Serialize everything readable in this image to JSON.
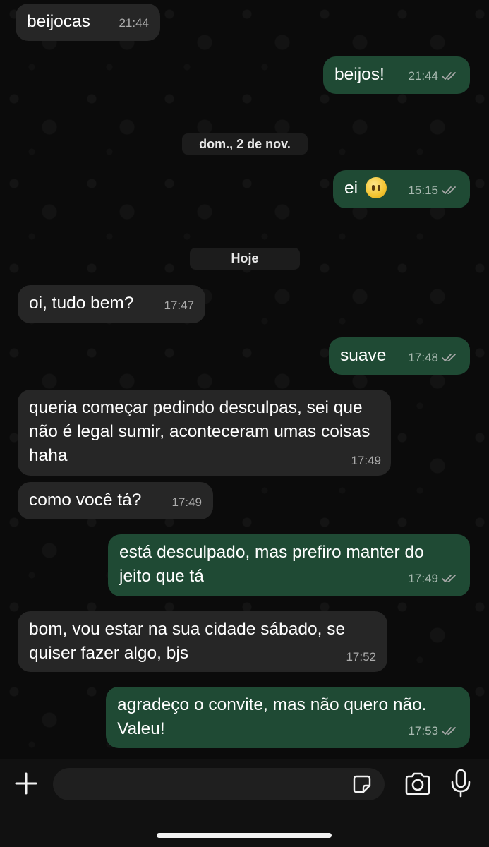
{
  "messages": [
    {
      "text": "beijocas",
      "time": "21:44"
    },
    {
      "text": "beijos!",
      "time": "21:44"
    },
    {
      "text": "ei",
      "time": "15:15",
      "emoji": "face-without-mouth"
    },
    {
      "text": "oi, tudo bem?",
      "time": "17:47"
    },
    {
      "text": "suave",
      "time": "17:48"
    },
    {
      "text": "queria começar pedindo desculpas, sei que não é legal sumir, aconteceram umas coisas haha",
      "time": "17:49"
    },
    {
      "text": "como você tá?",
      "time": "17:49"
    },
    {
      "text": "está desculpado, mas prefiro manter do jeito que tá",
      "time": "17:49"
    },
    {
      "text": "bom, vou estar na sua cidade sábado, se quiser fazer algo, bjs",
      "time": "17:52"
    },
    {
      "text": "agradeço o convite, mas não quero não. Valeu!",
      "time": "17:53"
    }
  ],
  "date_separators": [
    "dom., 2 de nov.",
    "Hoje"
  ],
  "input": {
    "placeholder": ""
  },
  "icons": [
    "plus-icon",
    "sticker-icon",
    "camera-icon",
    "microphone-icon",
    "read-receipt-icon"
  ],
  "colors": {
    "incoming": "#262626",
    "outgoing": "#1f4a34",
    "background": "#0b0b0b",
    "time": "#a8a8a8"
  }
}
